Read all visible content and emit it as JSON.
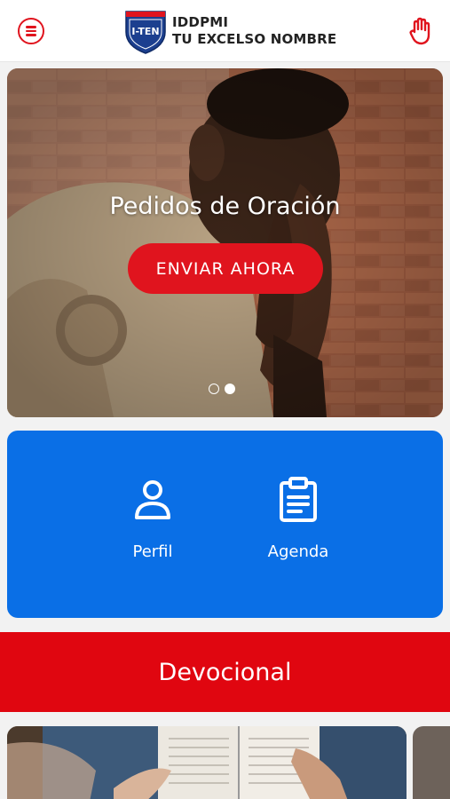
{
  "header": {
    "logo_text": "I-TEN",
    "brand_line1": "IDDPMI",
    "brand_line2": "TU EXCELSO NOMBRE",
    "icons": {
      "menu": "hamburger-icon",
      "action": "raised-hand-icon"
    }
  },
  "hero": {
    "title": "Pedidos de Oración",
    "cta_label": "ENVIAR AHORA",
    "slides_total": 2,
    "active_slide": 2
  },
  "quick_actions": [
    {
      "label": "Perfil",
      "icon": "user-icon"
    },
    {
      "label": "Agenda",
      "icon": "clipboard-icon"
    }
  ],
  "devocional": {
    "label": "Devocional"
  },
  "colors": {
    "accent_red": "#e0141e",
    "devocional_red": "#e00610",
    "panel_blue": "#0a6fe6",
    "header_bg": "#ffffff",
    "page_bg": "#f2f2f2"
  }
}
